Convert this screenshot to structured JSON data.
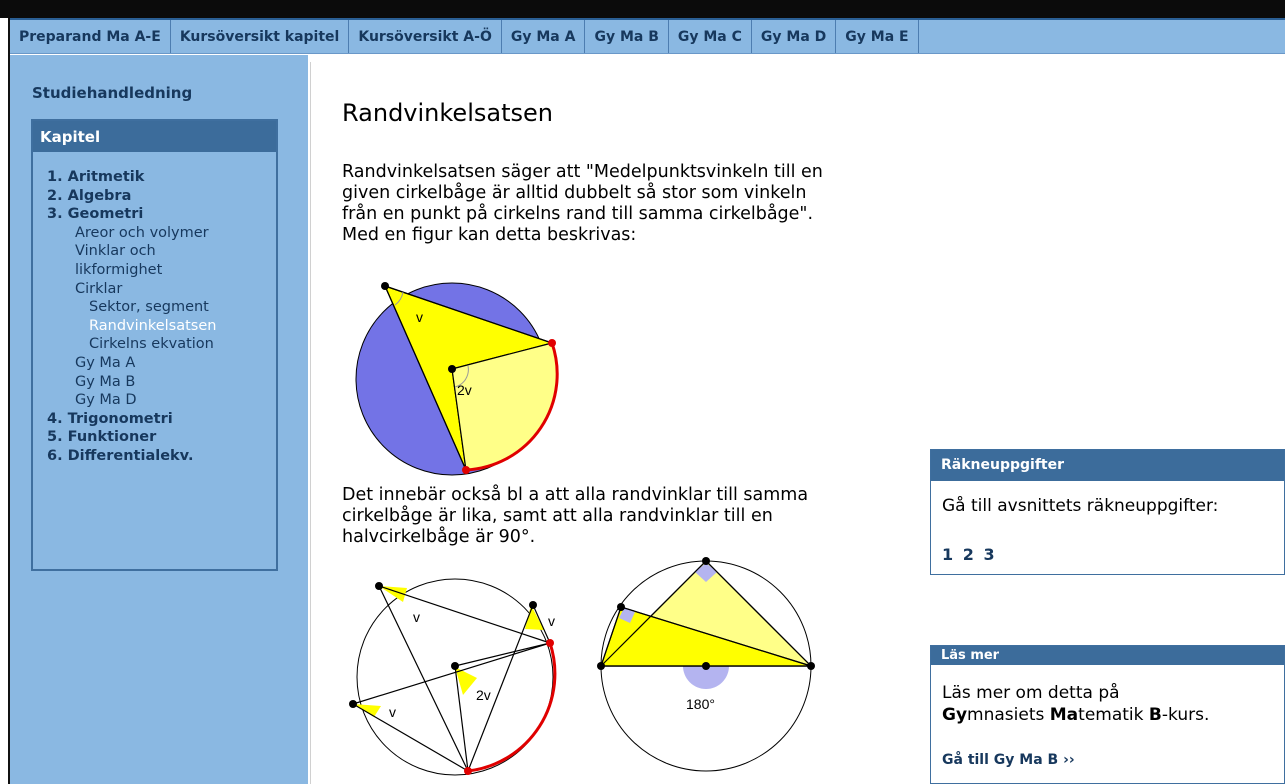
{
  "nav": {
    "items": [
      "Preparand Ma A-E",
      "Kursöversikt kapitel",
      "Kursöversikt A-Ö",
      "Gy Ma A",
      "Gy Ma B",
      "Gy Ma C",
      "Gy Ma D",
      "Gy Ma E"
    ]
  },
  "sidebar": {
    "study_link": "Studiehandledning",
    "chapter_title": "Kapitel",
    "chapters": [
      {
        "label": "1. Aritmetik",
        "level": 1
      },
      {
        "label": "2. Algebra",
        "level": 1
      },
      {
        "label": "3. Geometri",
        "level": 1
      },
      {
        "label": "Areor och volymer",
        "level": 2
      },
      {
        "label": "Vinklar och",
        "level": 2
      },
      {
        "label": "likformighet",
        "level": 2
      },
      {
        "label": "Cirklar",
        "level": 2
      },
      {
        "label": "Sektor, segment",
        "level": 3
      },
      {
        "label": "Randvinkelsatsen",
        "level": 3,
        "active": true
      },
      {
        "label": "Cirkelns ekvation",
        "level": 3
      },
      {
        "label": "Gy Ma A",
        "level": 2
      },
      {
        "label": "Gy Ma B",
        "level": 2
      },
      {
        "label": "Gy Ma D",
        "level": 2
      },
      {
        "label": "4. Trigonometri",
        "level": 1
      },
      {
        "label": "5. Funktioner",
        "level": 1
      },
      {
        "label": "6. Differentialekv.",
        "level": 1
      }
    ]
  },
  "main": {
    "title": "Randvinkelsatsen",
    "para1": [
      "Randvinkelsatsen säger att \"Medelpunktsvinkeln till en",
      "given cirkelbåge är alltid dubbelt så stor som vinkeln",
      "från en punkt på cirkelns rand till samma cirkelbåge\".",
      "Med en figur kan detta beskrivas:"
    ],
    "para2": [
      "Det innebär också bl a att alla randvinklar till samma",
      "cirkelbåge är lika, samt att alla randvinklar till en",
      "halvcirkelbåge är 90°."
    ],
    "fig_labels": {
      "v": "v",
      "two_v": "2v",
      "deg180": "180°"
    }
  },
  "exercises": {
    "title": "Räkneuppgifter",
    "text": "Gå till avsnittets räkneuppgifter:",
    "links": [
      "1",
      "2",
      "3"
    ]
  },
  "read_more": {
    "title": "Läs mer",
    "line1": "Läs mer om detta på",
    "line2_parts": [
      {
        "text": "Gy",
        "bold": true
      },
      {
        "text": "mnasiets ",
        "bold": false
      },
      {
        "text": "Ma",
        "bold": true
      },
      {
        "text": "tematik ",
        "bold": false
      },
      {
        "text": "B",
        "bold": true
      },
      {
        "text": "-kurs.",
        "bold": false
      }
    ],
    "link": "Gå till Gy Ma B ››"
  },
  "colors": {
    "nav_bg": "#8ab8e2",
    "header_bg": "#3c6c9b",
    "link": "#17385d",
    "circle_fill": "#7373e6",
    "yellow": "#ffff00",
    "light_yellow": "#ffff88",
    "red_arc": "#e00000"
  }
}
